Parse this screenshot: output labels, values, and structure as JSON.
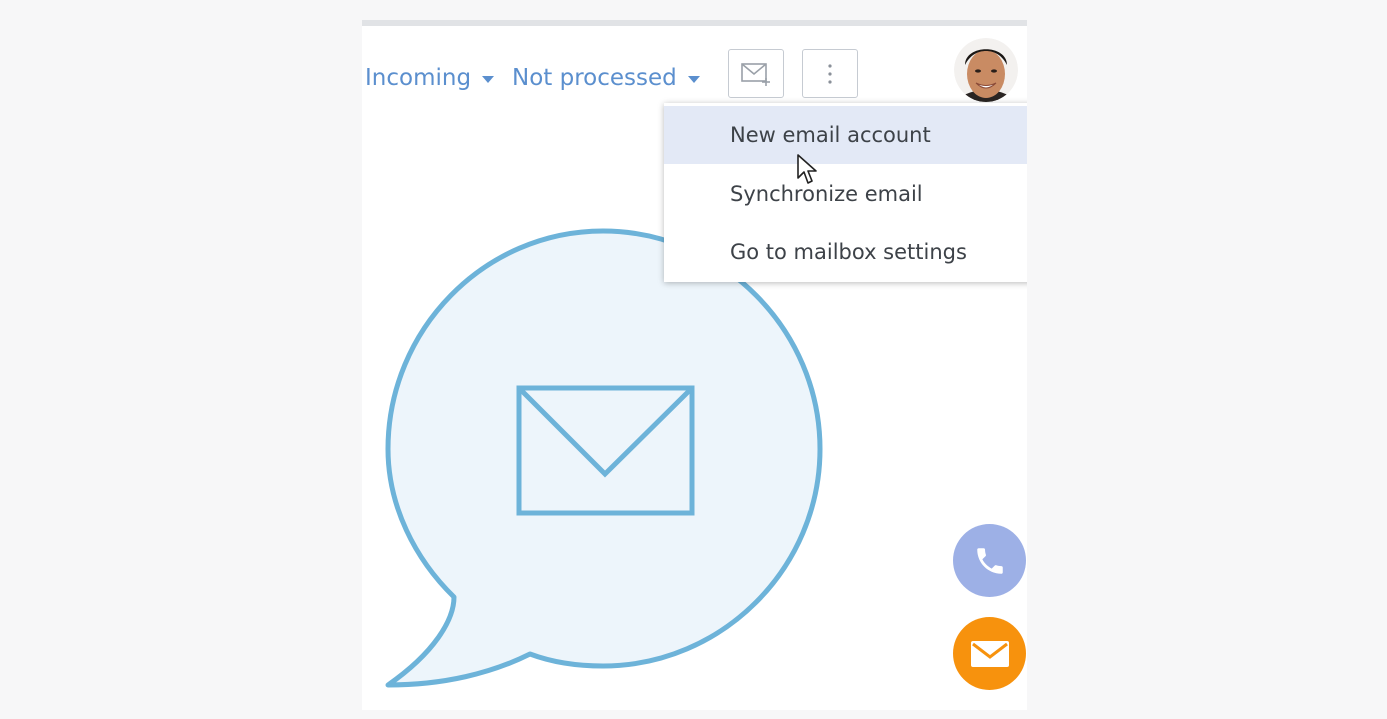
{
  "filters": {
    "incoming_label": "Incoming",
    "status_label": "Not processed"
  },
  "toolbar": {
    "new_email_icon": "envelope-plus-icon",
    "more_icon": "vertical-dots-icon"
  },
  "user": {
    "avatar": "user-avatar"
  },
  "actions_menu": {
    "items": [
      {
        "label": "New email account",
        "highlighted": true
      },
      {
        "label": "Synchronize email",
        "highlighted": false
      },
      {
        "label": "Go to mailbox settings",
        "highlighted": false
      }
    ]
  },
  "empty_state": {
    "illustration": "speech-bubble-envelope-icon"
  },
  "floating_buttons": {
    "phone_icon": "phone-icon",
    "mail_icon": "envelope-icon"
  },
  "colors": {
    "accent_blue": "#5b8fce",
    "illustration_stroke": "#6db3d9",
    "illustration_fill": "#edf5fb",
    "menu_highlight": "#e3e9f6",
    "phone_button": "#9db0e6",
    "mail_button": "#f7920d"
  }
}
